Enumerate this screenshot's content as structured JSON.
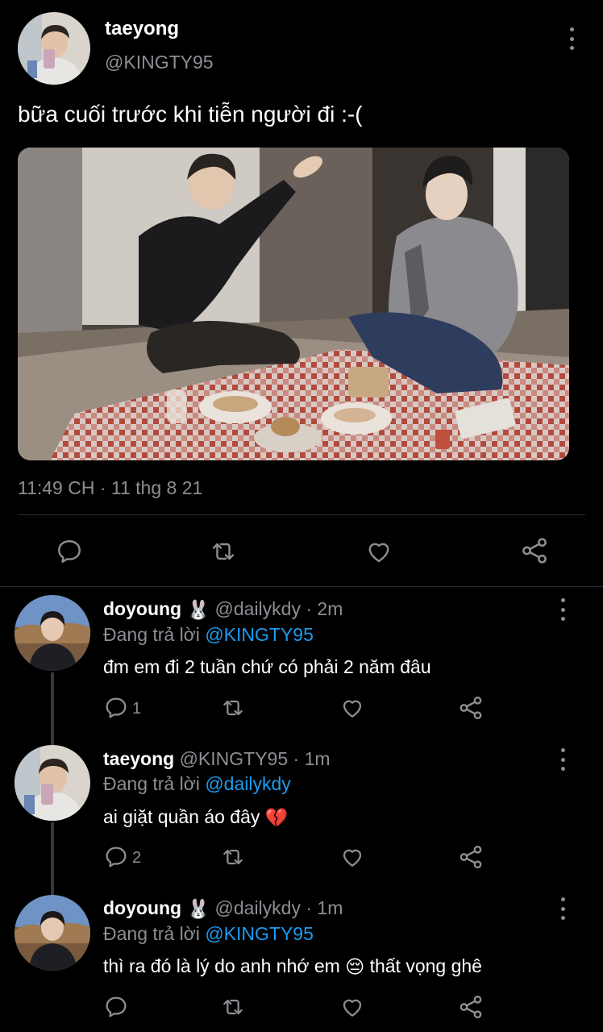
{
  "main_tweet": {
    "name": "taeyong",
    "handle": "@KINGTY95",
    "text": "bữa cuối trước khi tiễn người đi :-(",
    "timestamp": "11:49 CH · 11 thg 8 21",
    "actions": [
      "reply-icon",
      "retweet-icon",
      "like-icon",
      "share-icon"
    ]
  },
  "replies": [
    {
      "name": "doyoung",
      "name_emoji": "🐰",
      "handle": "@dailykdy",
      "time": "· 2m",
      "replying_prefix": "Đang trả lời",
      "replying_to": "@KINGTY95",
      "text": "đm em đi 2 tuần chứ có phải 2 năm đâu",
      "reply_count": "1"
    },
    {
      "name": "taeyong",
      "handle": "@KINGTY95",
      "time": "· 1m",
      "replying_prefix": "Đang trả lời",
      "replying_to": "@dailykdy",
      "text": "ai giặt quần áo đây",
      "text_emoji": "💔",
      "reply_count": "2"
    },
    {
      "name": "doyoung",
      "name_emoji": "🐰",
      "handle": "@dailykdy",
      "time": "· 1m",
      "replying_prefix": "Đang trả lời",
      "replying_to": "@KINGTY95",
      "text_before": "thì ra đó là lý do anh nhớ em",
      "text_emoji": "😔",
      "text_after": "thất vọng ghê",
      "reply_count": ""
    }
  ],
  "colors": {
    "background": "#000000",
    "text": "#ffffff",
    "secondary": "#8b8f94",
    "mention": "#1d9bf0"
  }
}
